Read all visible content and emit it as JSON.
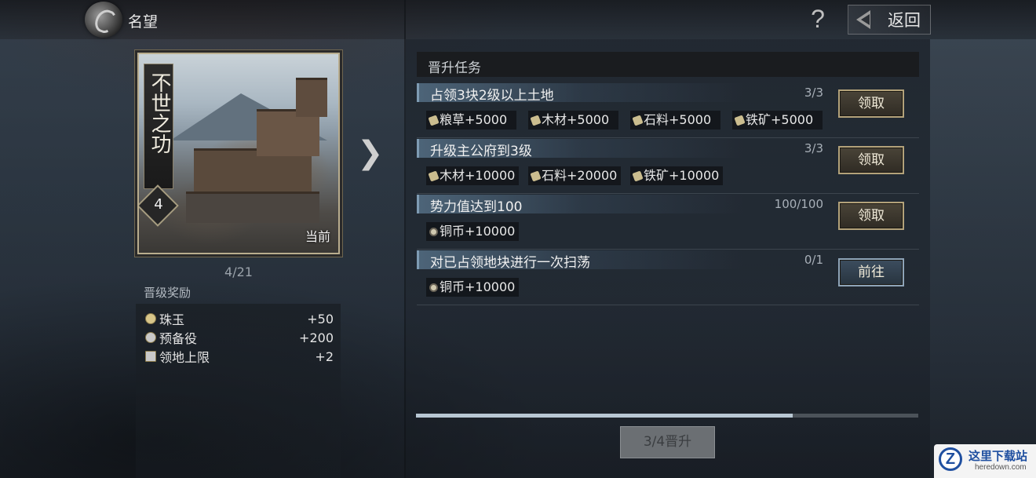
{
  "header": {
    "title": "名望",
    "help_label": "?",
    "back_label": "返回"
  },
  "card": {
    "title": "不世之功",
    "level": "4",
    "current_tag": "当前",
    "page_counter": "4/21"
  },
  "rewards": {
    "label": "晋级奖励",
    "items": [
      {
        "name": "珠玉",
        "value": "+50",
        "icon": "pearl-icon"
      },
      {
        "name": "预备役",
        "value": "+200",
        "icon": "reserve-troops-icon"
      },
      {
        "name": "领地上限",
        "value": "+2",
        "icon": "territory-icon"
      }
    ]
  },
  "tasks_section": {
    "title": "晋升任务"
  },
  "tasks": [
    {
      "title": "占领3块2级以上土地",
      "progress": "3/3",
      "button": "领取",
      "rewards": [
        "粮草+5000",
        "木材+5000",
        "石料+5000",
        "铁矿+5000"
      ]
    },
    {
      "title": "升级主公府到3级",
      "progress": "3/3",
      "button": "领取",
      "rewards": [
        "木材+10000",
        "石料+20000",
        "铁矿+10000"
      ]
    },
    {
      "title": "势力值达到100",
      "progress": "100/100",
      "button": "领取",
      "rewards": [
        "铜币+10000"
      ]
    },
    {
      "title": "对已占领地块进行一次扫荡",
      "progress": "0/1",
      "button": "前往",
      "rewards": [
        "铜币+10000"
      ]
    }
  ],
  "promotion": {
    "progress_fraction": 0.75,
    "button": "3/4晋升"
  },
  "watermark": {
    "badge": "Z",
    "name": "这里下载站",
    "url": "heredown.com"
  },
  "colors": {
    "gold_border": "#b3a27a",
    "blue_border": "#8ea4b8",
    "progress_fill": "#b8c7d3"
  }
}
